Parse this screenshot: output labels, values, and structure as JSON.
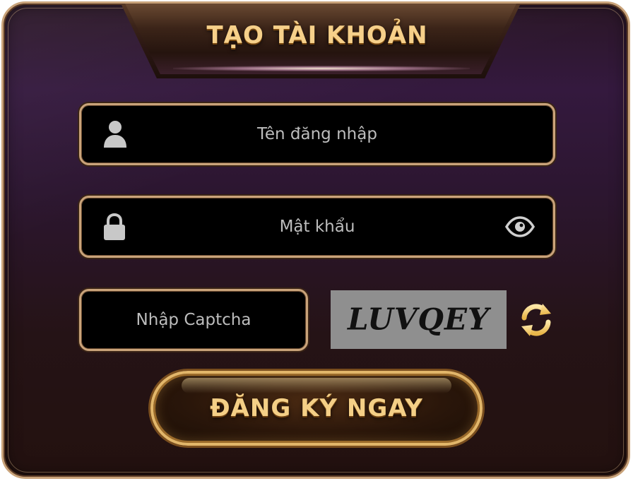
{
  "dialog": {
    "title": "TẠO TÀI KHOẢN"
  },
  "form": {
    "username_placeholder": "Tên đăng nhập",
    "password_placeholder": "Mật khẩu",
    "captcha_placeholder": "Nhập Captcha",
    "captcha_code": "LUVQEY",
    "submit_label": "ĐĂNG KÝ NGAY"
  },
  "icons": {
    "username": "user-icon",
    "password": "lock-icon",
    "toggle_password": "eye-icon",
    "refresh_captcha": "refresh-icon"
  },
  "colors": {
    "accent_gold": "#f6d08a",
    "border_gold": "#c9a37a",
    "placeholder": "#bdbdbd",
    "captcha_bg": "#8f8f8f"
  }
}
